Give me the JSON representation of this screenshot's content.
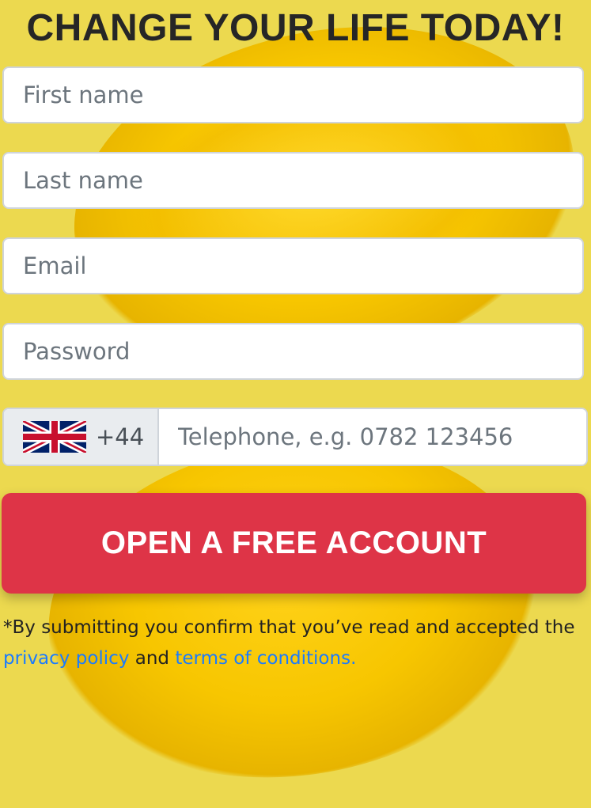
{
  "header": {
    "title": "CHANGE YOUR LIFE TODAY!"
  },
  "form": {
    "first_name_placeholder": "First name",
    "last_name_placeholder": "Last name",
    "email_placeholder": "Email",
    "password_placeholder": "Password",
    "phone": {
      "country_code": "+44",
      "flag": "uk-flag-icon",
      "placeholder": "Telephone, e.g. 0782 123456"
    },
    "submit_label": "OPEN A FREE ACCOUNT"
  },
  "disclaimer": {
    "text_before": "*By submitting you confirm that you’ve read and accepted the",
    "privacy_link": "privacy policy",
    "conjunction": "and",
    "terms_link": "terms of conditions."
  },
  "colors": {
    "background": "#ecd94f",
    "button": "#de3447",
    "link": "#1a7bff"
  }
}
